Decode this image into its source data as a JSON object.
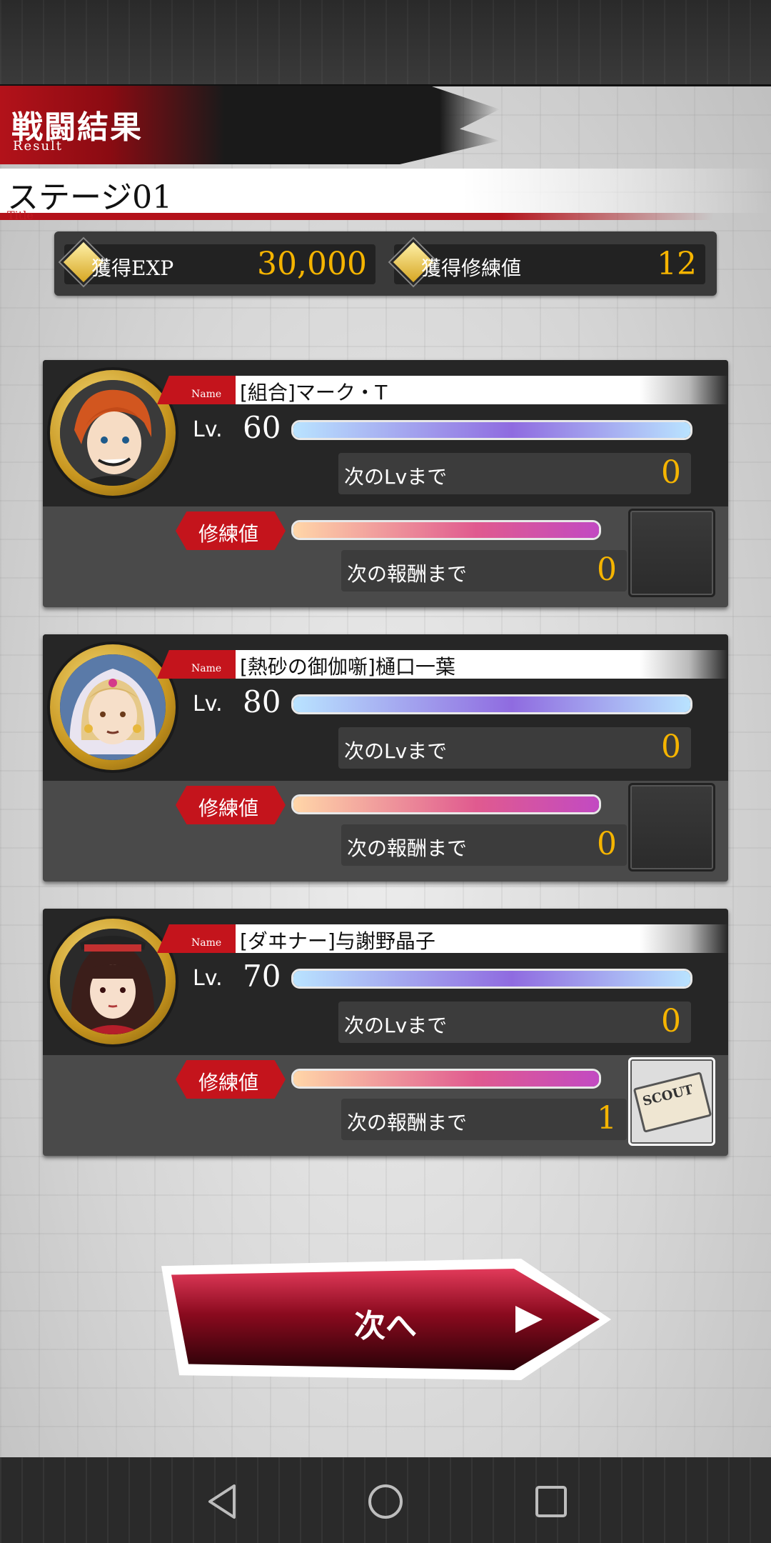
{
  "header": {
    "title": "戦闘結果",
    "subtitle": "Result"
  },
  "stage": {
    "name": "ステージ01",
    "sub": "Title"
  },
  "rewards": {
    "exp_label": "獲得EXP",
    "exp_value": "30,000",
    "training_label": "獲得修練値",
    "training_value": "12"
  },
  "characters": [
    {
      "name_tag": "Name",
      "name": "[組合]マーク・T",
      "lv_label": "Lv.",
      "level": "60",
      "lv_progress": 1.0,
      "next_lv_label": "次のLvまで",
      "next_lv_value": "0",
      "training_tag": "修練値",
      "training_progress": 1.0,
      "next_reward_label": "次の報酬まで",
      "next_reward_value": "0",
      "reward_item": ""
    },
    {
      "name_tag": "Name",
      "name": "[熱砂の御伽噺]樋口一葉",
      "lv_label": "Lv.",
      "level": "80",
      "lv_progress": 1.0,
      "next_lv_label": "次のLvまで",
      "next_lv_value": "0",
      "training_tag": "修練値",
      "training_progress": 1.0,
      "next_reward_label": "次の報酬まで",
      "next_reward_value": "0",
      "reward_item": ""
    },
    {
      "name_tag": "Name",
      "name": "[ダヰナー]与謝野晶子",
      "lv_label": "Lv.",
      "level": "70",
      "lv_progress": 1.0,
      "next_lv_label": "次のLvまで",
      "next_lv_value": "0",
      "training_tag": "修練値",
      "training_progress": 1.0,
      "next_reward_label": "次の報酬まで",
      "next_reward_value": "1",
      "reward_item": "Scout ticket"
    }
  ],
  "next_button": {
    "label": "次へ"
  },
  "navbar": {
    "icons": [
      "back-icon",
      "home-icon",
      "recent-apps-icon"
    ]
  },
  "colors": {
    "accent_red": "#c4141c",
    "value_gold": "#f5b400",
    "panel_dark": "#262626"
  }
}
